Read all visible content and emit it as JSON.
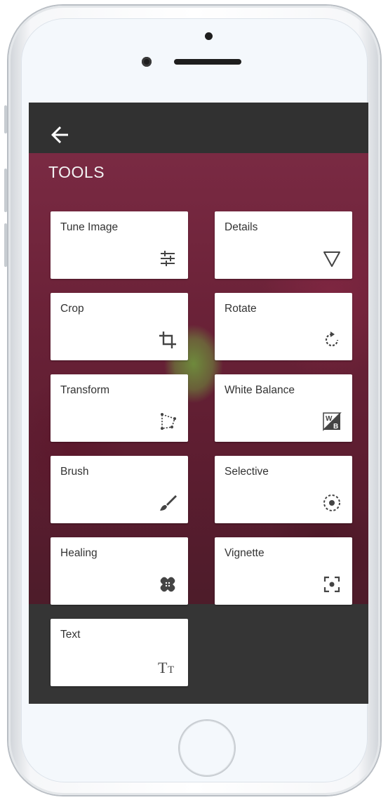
{
  "appbar": {
    "back_icon": "arrow-back-icon"
  },
  "tools": {
    "title": "TOOLS",
    "items": [
      {
        "label": "Tune Image",
        "icon": "tune-sliders-icon"
      },
      {
        "label": "Details",
        "icon": "details-triangle-icon"
      },
      {
        "label": "Crop",
        "icon": "crop-icon"
      },
      {
        "label": "Rotate",
        "icon": "rotate-icon"
      },
      {
        "label": "Transform",
        "icon": "transform-perspective-icon"
      },
      {
        "label": "White Balance",
        "icon": "white-balance-icon"
      },
      {
        "label": "Brush",
        "icon": "brush-icon"
      },
      {
        "label": "Selective",
        "icon": "selective-icon"
      },
      {
        "label": "Healing",
        "icon": "healing-bandage-icon"
      },
      {
        "label": "Vignette",
        "icon": "vignette-icon"
      },
      {
        "label": "Text",
        "icon": "text-icon"
      }
    ]
  },
  "colors": {
    "appbar": "#313131",
    "screen_background": "#353535",
    "tile": "#ffffff",
    "icon": "#444444",
    "label": "#333333"
  }
}
